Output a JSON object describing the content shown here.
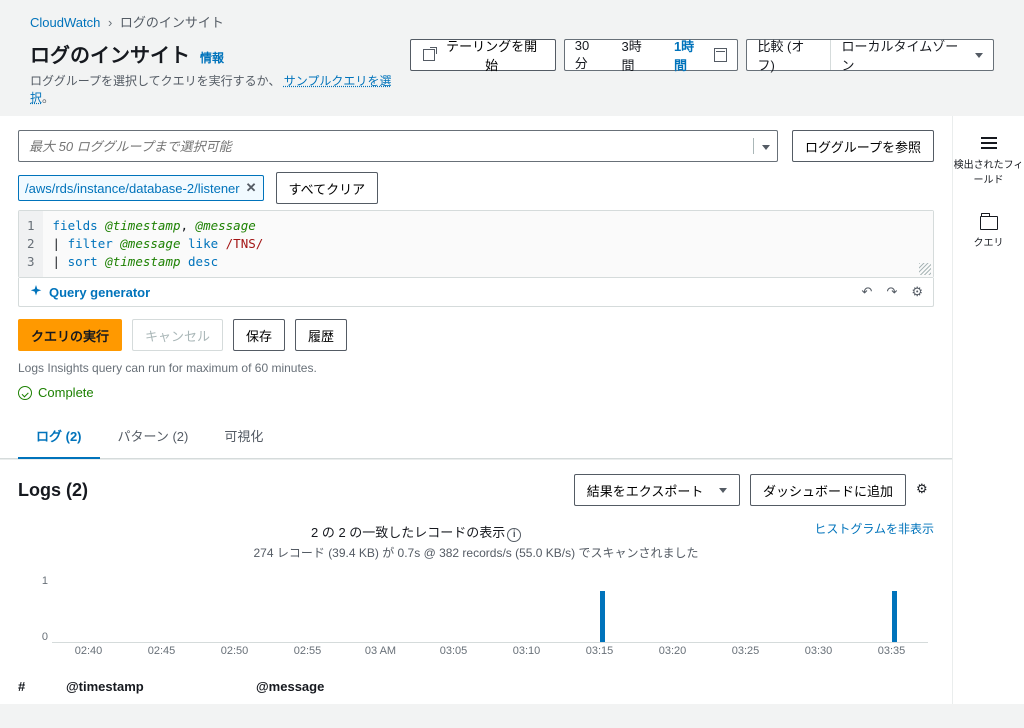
{
  "breadcrumb": {
    "root": "CloudWatch",
    "current": "ログのインサイト"
  },
  "header": {
    "title": "ログのインサイト",
    "info": "情報",
    "subtitle_prefix": "ロググループを選択してクエリを実行するか、",
    "subtitle_link": "サンプルクエリを選択",
    "subtitle_suffix": "。",
    "tailing_btn": "テーリングを開始",
    "range": {
      "m30": "30分",
      "h3": "3時間",
      "h1": "1時間"
    },
    "compare": "比較 (オフ)",
    "timezone": "ローカルタイムゾーン"
  },
  "side": {
    "fields": "検出されたフィールド",
    "queries": "クエリ"
  },
  "loggroup": {
    "placeholder": "最大 50 ロググループまで選択可能",
    "browse_btn": "ロググループを参照",
    "tag": "/aws/rds/instance/database-2/listener",
    "clear_all": "すべてクリア"
  },
  "query": {
    "line1_a": "fields",
    "line1_b": "@timestamp",
    "line1_c": ", ",
    "line1_d": "@message",
    "line2_a": "| ",
    "line2_b": "filter",
    "line2_c": " ",
    "line2_d": "@message",
    "line2_e": " like ",
    "line2_f": "/TNS/",
    "line3_a": "| ",
    "line3_b": "sort",
    "line3_c": " ",
    "line3_d": "@timestamp",
    "line3_e": " desc",
    "gutter": {
      "l1": "1",
      "l2": "2",
      "l3": "3"
    },
    "generator": "Query generator"
  },
  "actions": {
    "run": "クエリの実行",
    "cancel": "キャンセル",
    "save": "保存",
    "history": "履歴"
  },
  "hint": "Logs Insights query can run for maximum of 60 minutes.",
  "status": "Complete",
  "tabs": {
    "logs": "ログ (2)",
    "patterns": "パターン  (2)",
    "viz": "可視化"
  },
  "results": {
    "title": "Logs (2)",
    "export": "結果をエクスポート",
    "add_dash": "ダッシュボードに追加",
    "stats_main": "2 の 2 の一致したレコードの表示",
    "stats_sub": "274 レコード (39.4 KB) が 0.7s @ 382 records/s (55.0 KB/s) でスキャンされました",
    "hide_hist": "ヒストグラムを非表示"
  },
  "table": {
    "h1": "#",
    "h2": "@timestamp",
    "h3": "@message"
  },
  "chart_data": {
    "type": "bar",
    "categories": [
      "02:40",
      "02:45",
      "02:50",
      "02:55",
      "03 AM",
      "03:05",
      "03:10",
      "03:15",
      "03:20",
      "03:25",
      "03:30",
      "03:35"
    ],
    "values": [
      0,
      0,
      0,
      0,
      0,
      0,
      0,
      1,
      0,
      0,
      0,
      1
    ],
    "ylabel": "",
    "xlabel": "",
    "ylim": [
      0,
      1
    ],
    "yticks": [
      "1",
      "0"
    ]
  }
}
